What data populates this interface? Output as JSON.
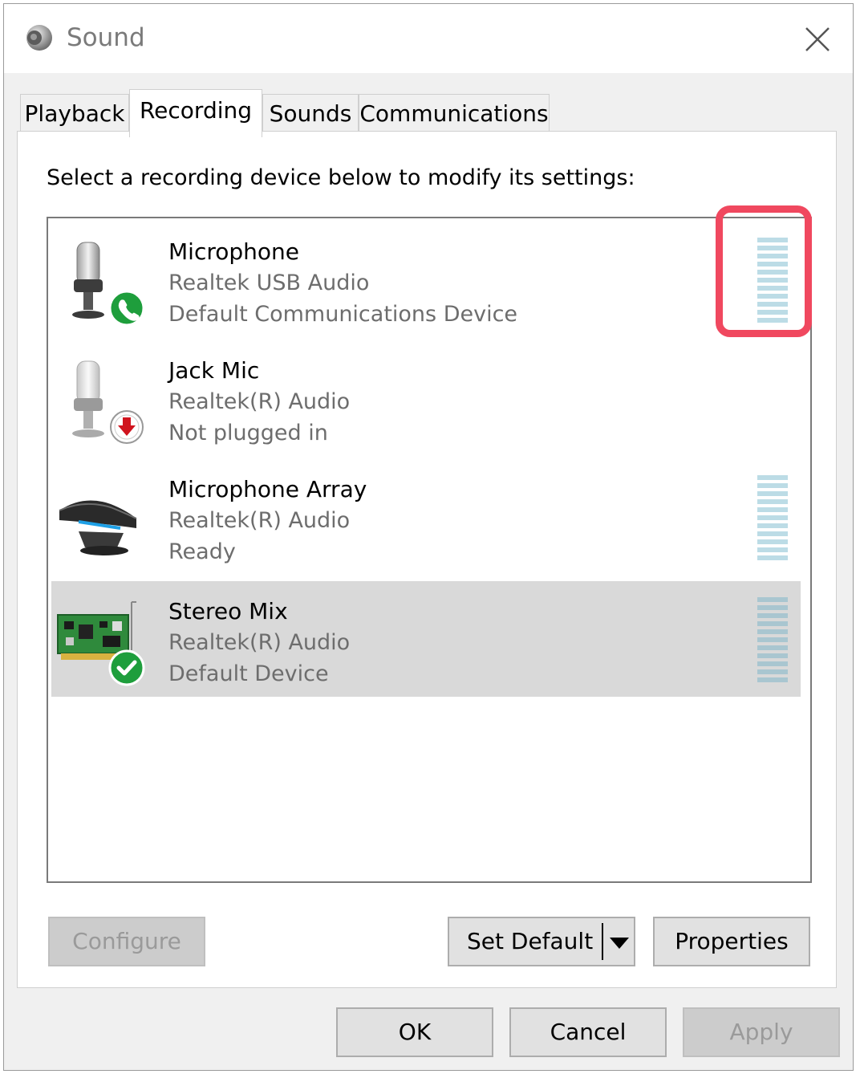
{
  "window": {
    "title": "Sound"
  },
  "tabs": [
    {
      "label": "Playback"
    },
    {
      "label": "Recording"
    },
    {
      "label": "Sounds"
    },
    {
      "label": "Communications"
    }
  ],
  "active_tab": "Recording",
  "instruction": "Select a recording device below to modify its settings:",
  "devices": [
    {
      "name": "Microphone",
      "driver": "Realtek USB Audio",
      "status": "Default Communications Device",
      "icon": "microphone-phone-icon",
      "meter_level": 0.0
    },
    {
      "name": "Jack Mic",
      "driver": "Realtek(R) Audio",
      "status": "Not plugged in",
      "icon": "microphone-unplugged-icon"
    },
    {
      "name": "Microphone Array",
      "driver": "Realtek(R) Audio",
      "status": "Ready",
      "icon": "microphone-array-icon",
      "meter_level": 0.0
    },
    {
      "name": "Stereo Mix",
      "driver": "Realtek(R) Audio",
      "status": "Default Device",
      "icon": "sound-card-check-icon",
      "meter_level": 0.0,
      "selected": true
    }
  ],
  "buttons": {
    "configure": "Configure",
    "set_default": "Set Default",
    "properties": "Properties",
    "ok": "OK",
    "cancel": "Cancel",
    "apply": "Apply"
  },
  "colors": {
    "highlight": "#f0485f",
    "meter_bar": "#bcdce6",
    "selected_row": "#d9d9d9"
  }
}
